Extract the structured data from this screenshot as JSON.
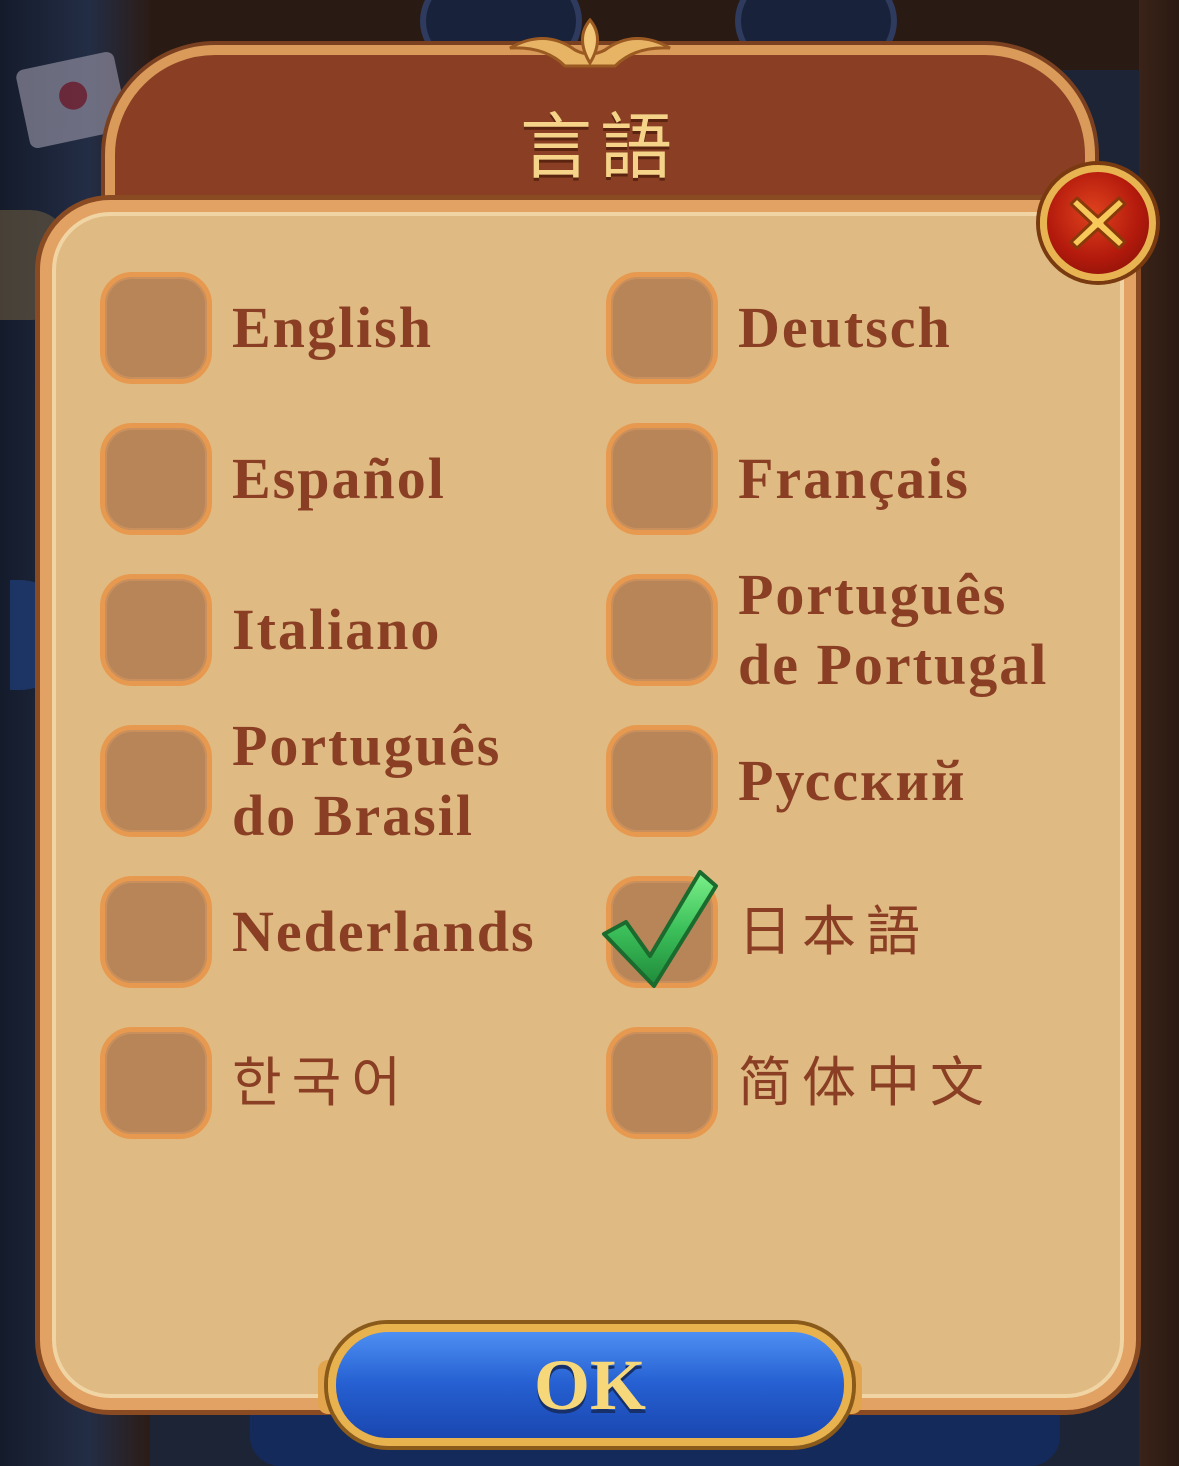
{
  "dialog": {
    "title": "言語",
    "close_icon": "close-icon",
    "ok_label": "OK"
  },
  "languages": [
    {
      "label": "English",
      "checked": false
    },
    {
      "label": "Deutsch",
      "checked": false
    },
    {
      "label": "Español",
      "checked": false
    },
    {
      "label": "Français",
      "checked": false
    },
    {
      "label": "Italiano",
      "checked": false
    },
    {
      "label_line1": "Português",
      "label_line2": "de Portugal",
      "checked": false
    },
    {
      "label_line1": "Português",
      "label_line2": "do Brasil",
      "checked": false
    },
    {
      "label": "Русский",
      "checked": false
    },
    {
      "label": "Nederlands",
      "checked": false
    },
    {
      "label": "日本語",
      "checked": true
    },
    {
      "label": "한국어",
      "checked": false
    },
    {
      "label": "简体中文",
      "checked": false
    }
  ],
  "colors": {
    "header": "#8a3f24",
    "body": "#dfbb83",
    "label": "#8a3f24",
    "checkbox": "#b88558",
    "ok_button": "#2660d2",
    "check_green": "#3cc05a"
  }
}
